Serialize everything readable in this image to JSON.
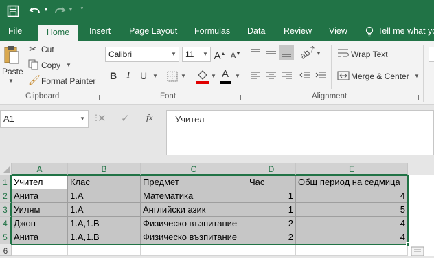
{
  "tabs": [
    "File",
    "Home",
    "Insert",
    "Page Layout",
    "Formulas",
    "Data",
    "Review",
    "View"
  ],
  "tell_me": "Tell me what yo",
  "clipboard": {
    "paste": "Paste",
    "cut": "Cut",
    "copy": "Copy",
    "format_painter": "Format Painter",
    "label": "Clipboard"
  },
  "font": {
    "name": "Calibri",
    "size": "11",
    "label": "Font"
  },
  "alignment": {
    "wrap_text": "Wrap Text",
    "merge_center": "Merge & Center",
    "label": "Alignment"
  },
  "name_box": "A1",
  "formula_content": "Учител",
  "columns": [
    "A",
    "B",
    "C",
    "D",
    "E"
  ],
  "rows": [
    "1",
    "2",
    "3",
    "4",
    "5",
    "6"
  ],
  "table": [
    [
      "Учител",
      "Клас",
      "Предмет",
      "Час",
      "Общ период на седмица"
    ],
    [
      "Анита",
      "1.А",
      "Математика",
      "1",
      "4"
    ],
    [
      "Уилям",
      "1.А",
      "Английски азик",
      "1",
      "5"
    ],
    [
      "Джон",
      "1.А,1.В",
      "Физическо възпитание",
      "2",
      "4"
    ],
    [
      "Анита",
      "1.А,1.В",
      "Физическо възпитание",
      "2",
      "4"
    ]
  ],
  "colors": {
    "brand": "#217346",
    "selection": "#c6c6c6",
    "underline_red": "#e00000"
  }
}
